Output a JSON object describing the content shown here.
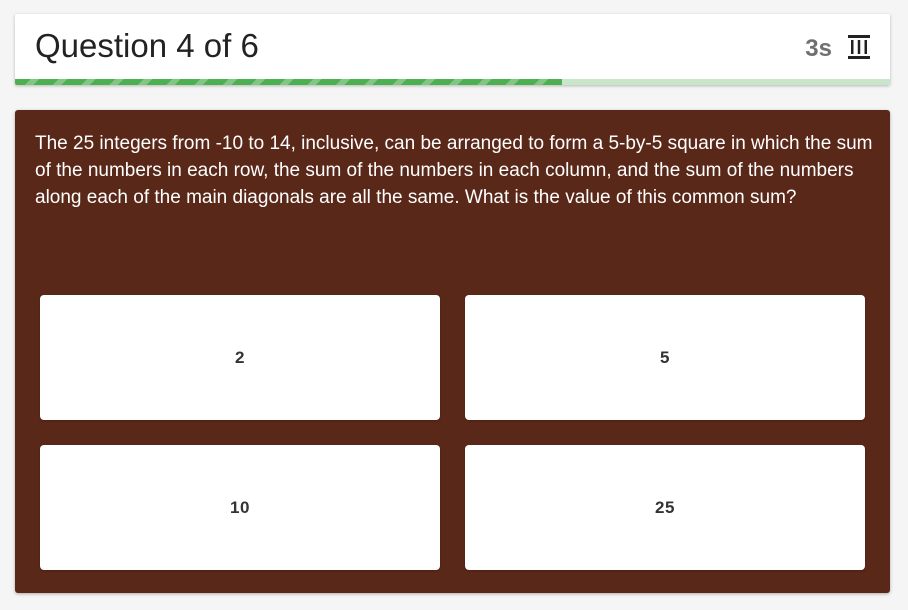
{
  "header": {
    "title": "Question 4 of 6",
    "timer": "3s",
    "timer_icon": "hourglass-icon",
    "progress_fraction": 0.625,
    "progress_color": "#4caf50",
    "progress_track_color": "#c8e6c9"
  },
  "question": {
    "text": "The 25 integers from -10 to 14, inclusive, can be arranged to form a 5-by-5 square in which the sum of the numbers in each row, the sum of the numbers in each column, and the sum of the numbers along each of the main diagonals are all the same. What is the value of this common sum?",
    "background_color": "#5a2819"
  },
  "options": [
    {
      "label": "2"
    },
    {
      "label": "5"
    },
    {
      "label": "10"
    },
    {
      "label": "25"
    }
  ]
}
